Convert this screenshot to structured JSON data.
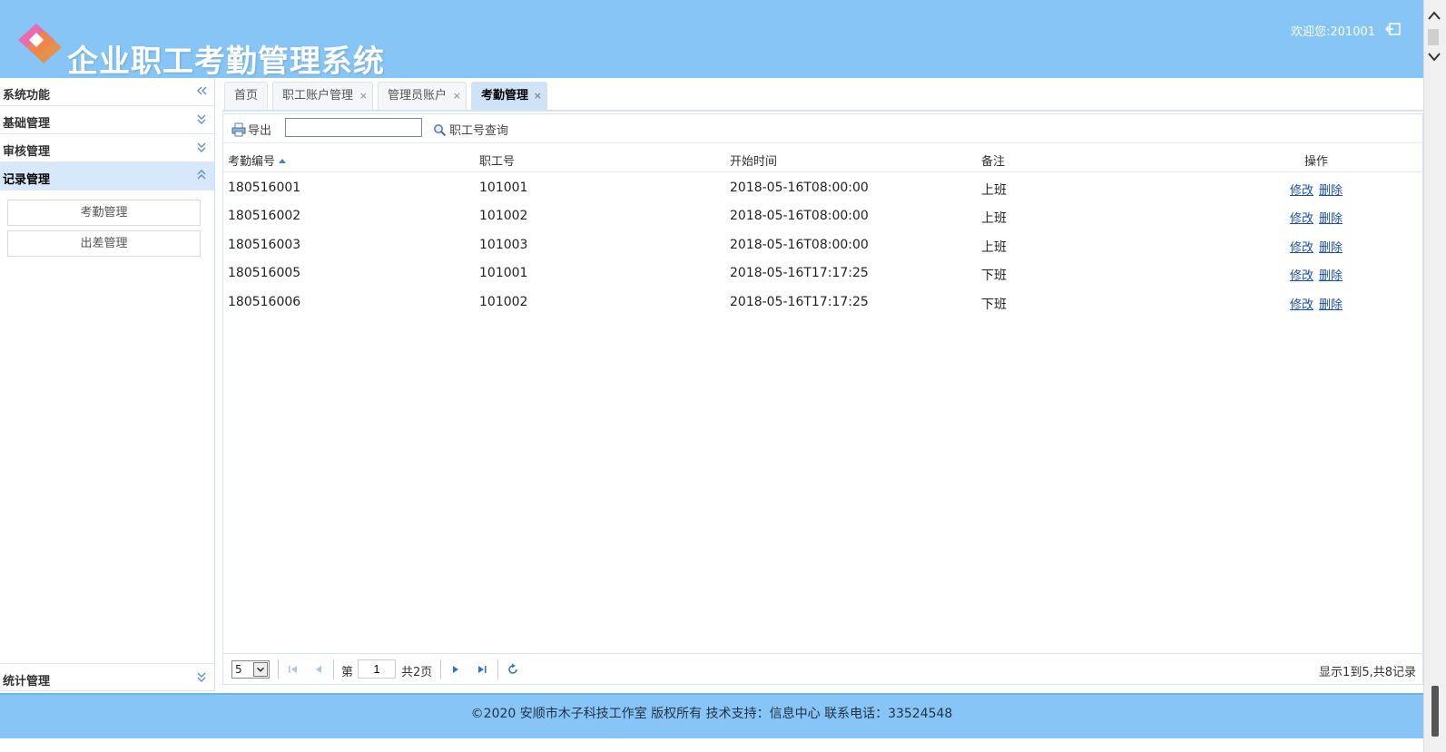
{
  "header": {
    "app_title": "企业职工考勤管理系统",
    "welcome": "欢迎您:201001",
    "logo_icon": "diamond-logo-icon",
    "logout_icon": "logout-icon",
    "bg_color": "#86c5f5"
  },
  "sidebar": {
    "title": "系统功能",
    "groups": [
      {
        "label": "基础管理",
        "expanded": false
      },
      {
        "label": "审核管理",
        "expanded": false
      },
      {
        "label": "记录管理",
        "expanded": true
      },
      {
        "label": "统计管理",
        "expanded": false
      }
    ],
    "sub_items": [
      "考勤管理",
      "出差管理"
    ]
  },
  "tabs": [
    {
      "label": "首页",
      "closable": false
    },
    {
      "label": "职工账户管理",
      "closable": true
    },
    {
      "label": "管理员账户",
      "closable": true
    },
    {
      "label": "考勤管理",
      "closable": true,
      "active": true
    }
  ],
  "tab_close_glyph": "×",
  "toolbar": {
    "export_label": "导出",
    "search_value": "",
    "query_label": "职工号查询"
  },
  "grid": {
    "columns": [
      "考勤编号",
      "职工号",
      "开始时间",
      "备注",
      "操作"
    ],
    "rows": [
      {
        "id": "180516001",
        "emp": "101001",
        "start": "2018-05-16T08:00:00",
        "note": "上班"
      },
      {
        "id": "180516002",
        "emp": "101002",
        "start": "2018-05-16T08:00:00",
        "note": "上班"
      },
      {
        "id": "180516003",
        "emp": "101003",
        "start": "2018-05-16T08:00:00",
        "note": "上班"
      },
      {
        "id": "180516005",
        "emp": "101001",
        "start": "2018-05-16T17:17:25",
        "note": "下班"
      },
      {
        "id": "180516006",
        "emp": "101002",
        "start": "2018-05-16T17:17:25",
        "note": "下班"
      }
    ],
    "edit_label": "修改",
    "delete_label": "删除"
  },
  "pager": {
    "page_size": "5",
    "page_prefix": "第",
    "page_number": "1",
    "page_total": "共2页",
    "info": "显示1到5,共8记录"
  },
  "footer": {
    "text": "©2020 安顺市木子科技工作室  版权所有 技术支持：信息中心 联系电话：33524548"
  }
}
